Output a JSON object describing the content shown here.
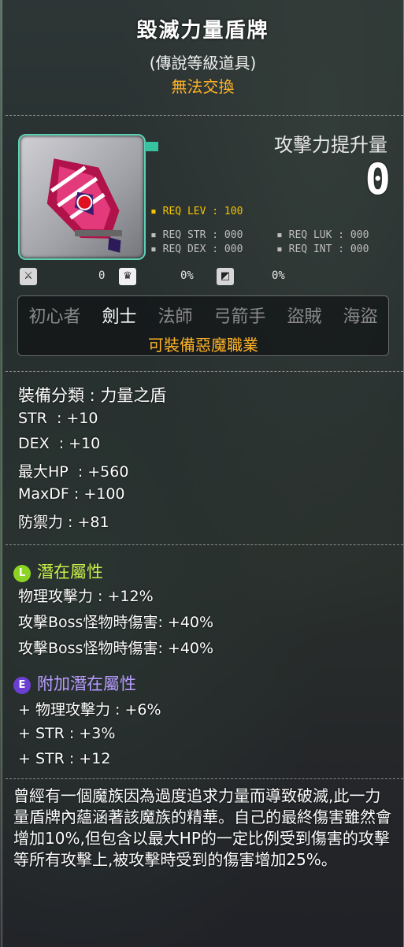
{
  "item": {
    "name": "毀滅力量盾牌",
    "grade": "(傳說等級道具)",
    "trade_status": "無法交換"
  },
  "attack_gain": {
    "label": "攻擊力提升量",
    "value": "0"
  },
  "requirements": {
    "lev": "REQ LEV : 100",
    "str": "REQ STR : 000",
    "luk": "REQ LUK : 000",
    "dex": "REQ DEX : 000",
    "int": "REQ INT : 000"
  },
  "stat_icons": [
    {
      "icon": "sword-shield-icon",
      "value": "0"
    },
    {
      "icon": "upgrade-crown-icon",
      "value": "0%"
    },
    {
      "icon": "shield-block-icon",
      "value": "0%"
    }
  ],
  "jobs": [
    {
      "label": "初心者",
      "enabled": false
    },
    {
      "label": "劍士",
      "enabled": true
    },
    {
      "label": "法師",
      "enabled": false
    },
    {
      "label": "弓箭手",
      "enabled": false
    },
    {
      "label": "盜賊",
      "enabled": false
    },
    {
      "label": "海盜",
      "enabled": false
    }
  ],
  "demon_note": "可裝備惡魔職業",
  "stats": [
    "裝備分類 : 力量之盾",
    "STR  : +10",
    "DEX  : +10",
    "最大HP  : +560",
    "MaxDF : +100",
    "防禦力 : +81"
  ],
  "potential": {
    "badge": "L",
    "title": "潛在屬性",
    "lines": [
      "物理攻擊力 : +12%",
      "攻擊Boss怪物時傷害: +40%",
      "攻擊Boss怪物時傷害: +40%"
    ]
  },
  "bonus_potential": {
    "badge": "E",
    "title": "附加潛在屬性",
    "lines": [
      "+ 物理攻擊力 : +6%",
      "+ STR : +3%",
      "+ STR : +12"
    ]
  },
  "description": "曾經有一個魔族因為過度追求力量而導致破滅,此一力量盾牌內蘊涵著該魔族的精華。自己的最終傷害雖然會增加10%,但包含以最大HP的一定比例受到傷害的攻擊等所有攻擊上,被攻擊時受到的傷害增加25%。",
  "colors": {
    "accent_orange": "#ffb326",
    "req_level": "#f4c300",
    "potential_title": "#c8f04a",
    "potential_badge": "#8cd423",
    "bonus_title": "#b79cff",
    "bonus_badge": "#6a3fd1",
    "icon_frame": "#5ed1b3"
  }
}
